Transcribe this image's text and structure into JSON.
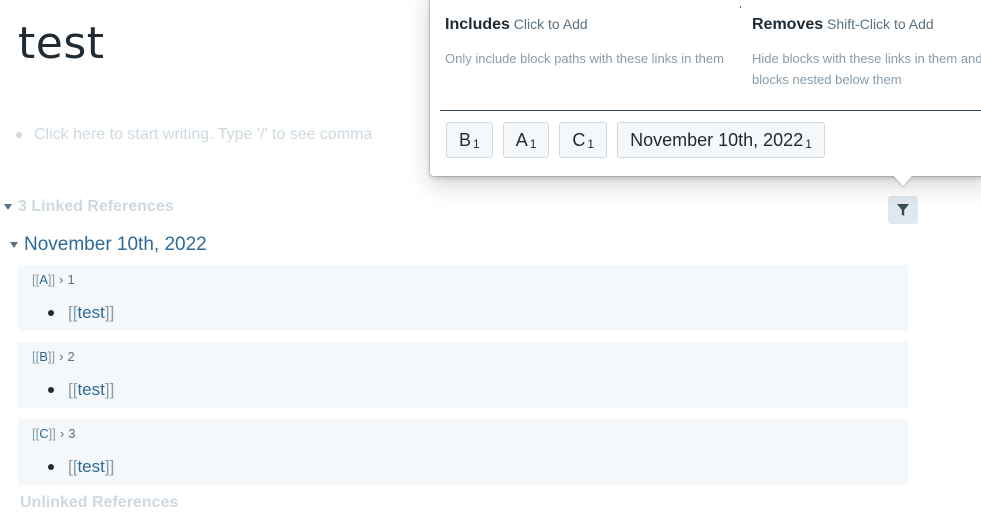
{
  "page": {
    "title": "test",
    "placeholder": "Click here to start writing. Type '/' to see comma"
  },
  "references": {
    "linked_label": "3 Linked References",
    "unlinked_label": "Unlinked References",
    "group": {
      "title": "November 10th, 2022",
      "blocks": [
        {
          "crumb_page": "A",
          "crumb_index": "1",
          "child_page": "test"
        },
        {
          "crumb_page": "B",
          "crumb_index": "2",
          "child_page": "test"
        },
        {
          "crumb_page": "C",
          "crumb_index": "3",
          "child_page": "test"
        }
      ]
    }
  },
  "filter_popover": {
    "includes": {
      "title": "Includes",
      "hint": "Click to Add",
      "description": "Only include block paths with these links in them"
    },
    "removes": {
      "title": "Removes",
      "hint": "Shift-Click to Add",
      "description": "Hide blocks with these links in them and all blocks nested below them"
    },
    "tags": [
      {
        "label": "B",
        "count": "1"
      },
      {
        "label": "A",
        "count": "1"
      },
      {
        "label": "C",
        "count": "1"
      },
      {
        "label": "November 10th, 2022",
        "count": "1"
      }
    ]
  },
  "icons": {
    "filter": "filter-icon",
    "caret": "caret-down-icon"
  },
  "colors": {
    "link": "#2d6a99",
    "muted": "#ced9e0",
    "block_bg": "#f5f8fa"
  }
}
